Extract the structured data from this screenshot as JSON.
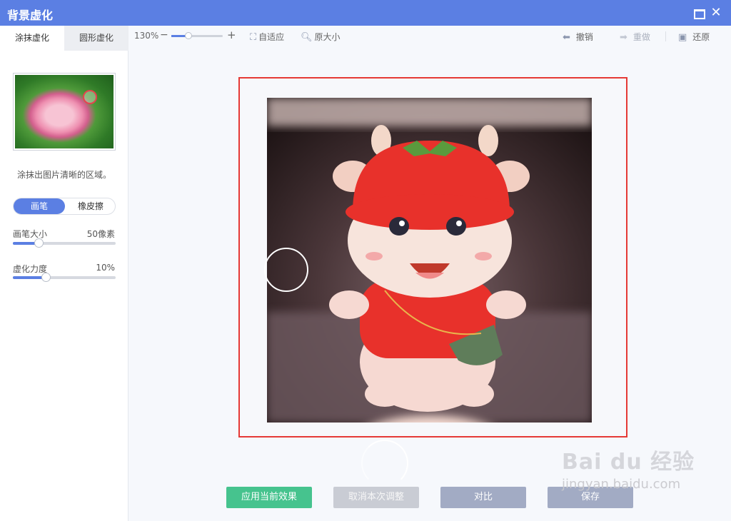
{
  "window": {
    "title": "背景虚化"
  },
  "left_panel": {
    "tabs": [
      {
        "label": "涂抹虚化"
      },
      {
        "label": "圆形虚化"
      }
    ],
    "hint": "涂抹出图片清晰的区域。",
    "mode_toggle": {
      "brush": "画笔",
      "eraser": "橡皮擦",
      "selected": "画笔"
    },
    "brush_size": {
      "label": "画笔大小",
      "value": "50像素",
      "level": 0.25
    },
    "blur_strength": {
      "label": "虚化力度",
      "value": "10%",
      "level": 0.32
    }
  },
  "toolbar": {
    "zoom": "130%",
    "zoom_out_icon": "−",
    "zoom_in_icon": "+",
    "fit_label": "自适应",
    "original_size_label": "原大小",
    "undo_label": "撤销",
    "redo_label": "重做",
    "restore_label": "还原"
  },
  "buttons": {
    "apply": "应用当前效果",
    "cancel": "取消本次调整",
    "compare": "对比",
    "save": "保存"
  },
  "watermark": {
    "brand": "Bai du 经验",
    "url": "jingyan.baidu.com"
  },
  "colors": {
    "accent": "#5b7fe3",
    "apply": "#46c38e",
    "frame": "#e53935"
  }
}
